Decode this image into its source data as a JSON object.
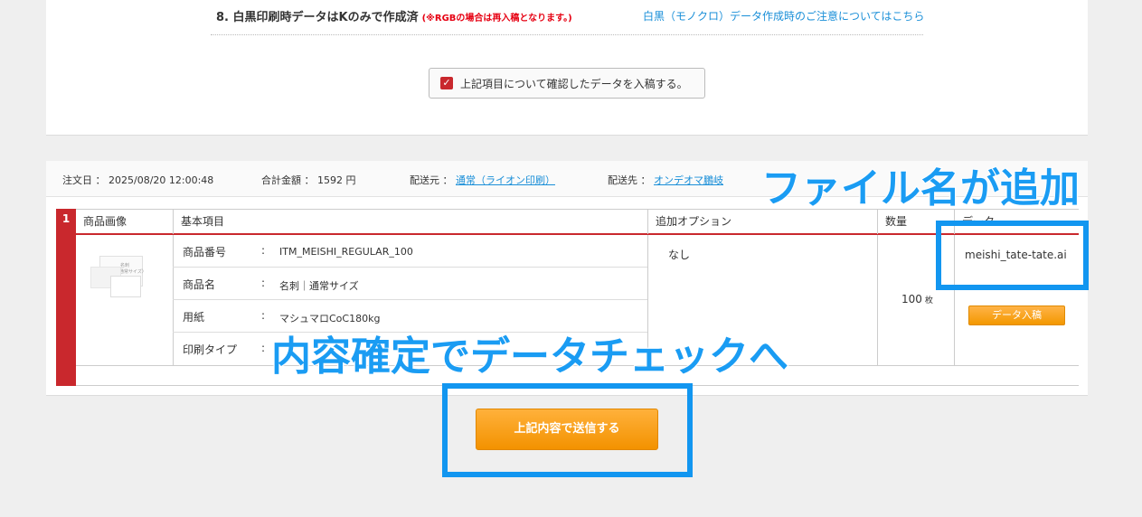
{
  "confirm_section": {
    "item8_title": "8. 白黒印刷時データはKのみで作成済",
    "item8_note": "(※RGBの場合は再入稿となります。)",
    "item8_link": "白黒（モノクロ）データ作成時のご注意についてはこちら",
    "checkbox_label": "上記項目について確認したデータを入稿する。",
    "checkbox_checked": true
  },
  "order_info": {
    "date_label": "注文日",
    "date_value": "2025/08/20 12:00:48",
    "total_label": "合計金額",
    "total_value": "1592 円",
    "ship_from_label": "配送元",
    "ship_from_value": "通常（ライオン印刷）",
    "ship_to_label": "配送先",
    "ship_to_value": "オンデオマ鵬岐"
  },
  "table": {
    "row_number": "1",
    "headers": {
      "image": "商品画像",
      "basic": "基本項目",
      "options": "追加オプション",
      "quantity": "数量",
      "data": "データ"
    },
    "colon": ":",
    "basic_rows": [
      {
        "label": "商品番号",
        "value": "ITM_MEISHI_REGULAR_100"
      },
      {
        "label": "商品名",
        "value": "名刺｜通常サイズ"
      },
      {
        "label": "用紙",
        "value": "マシュマロCoC180kg"
      },
      {
        "label": "印刷タイプ",
        "value": ""
      }
    ],
    "options_value": "なし",
    "quantity_value": "100",
    "quantity_unit": "枚",
    "filename": "meishi_tate-tate.ai",
    "upload_button": "データ入稿",
    "thumbnail_text": {
      "title": "名刺",
      "subtitle": "（通常サイズ）"
    }
  },
  "submit_button": "上記内容で送信する",
  "annotations": {
    "filename_added": "ファイル名が追加",
    "confirm_to_check": "内容確定でデータチェックへ"
  }
}
